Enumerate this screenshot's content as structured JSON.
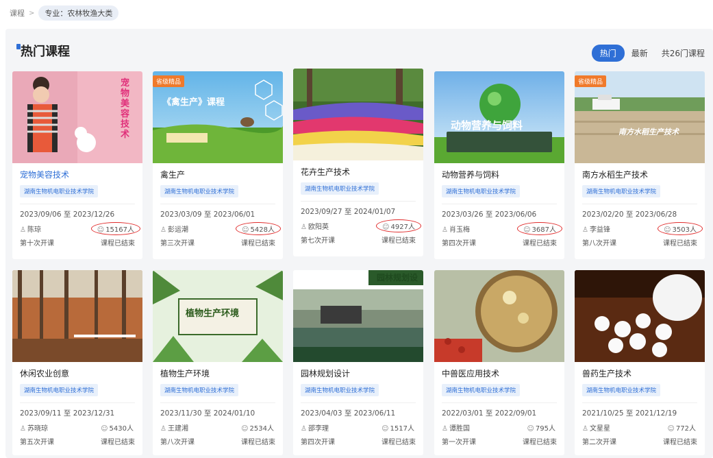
{
  "breadcrumb": {
    "root": "课程",
    "separator": ">",
    "current": "专业：农林牧渔大类"
  },
  "header": {
    "title": "热门课程",
    "tabs": [
      {
        "label": "热门",
        "active": true
      },
      {
        "label": "最新",
        "active": false
      }
    ],
    "count": "共26门课程"
  },
  "colors": {
    "accent": "#2f6fd6",
    "badge": "#f07a2b",
    "highlight_circle": "#e02a2a"
  },
  "courses": [
    {
      "name": "宠物美容技术",
      "school": "湖南生物机电职业技术学院",
      "dates": "2023/09/06 至 2023/12/26",
      "teacher": "陈琼",
      "learners": "15167人",
      "session": "第十次开课",
      "status": "课程已结束",
      "badge": "",
      "thumb_text": "宠物美容技术"
    },
    {
      "name": "禽生产",
      "school": "湖南生物机电职业技术学院",
      "dates": "2023/03/09 至 2023/06/01",
      "teacher": "彭运潮",
      "learners": "5428人",
      "session": "第三次开课",
      "status": "课程已结束",
      "badge": "省级精品",
      "thumb_text": "《禽生产》课程"
    },
    {
      "name": "花卉生产技术",
      "school": "湖南生物机电职业技术学院",
      "dates": "2023/09/27 至 2024/01/07",
      "teacher": "欧阳英",
      "learners": "4927人",
      "session": "第七次开课",
      "status": "课程已结束",
      "badge": "",
      "thumb_text": ""
    },
    {
      "name": "动物营养与饲料",
      "school": "湖南生物机电职业技术学院",
      "dates": "2023/03/26 至 2023/06/06",
      "teacher": "肖玉梅",
      "learners": "3687人",
      "session": "第四次开课",
      "status": "课程已结束",
      "badge": "",
      "thumb_text": "动物营养与饲料"
    },
    {
      "name": "南方水稻生产技术",
      "school": "湖南生物机电职业技术学院",
      "dates": "2023/02/20 至 2023/06/28",
      "teacher": "李益锋",
      "learners": "3503人",
      "session": "第八次开课",
      "status": "课程已结束",
      "badge": "省级精品",
      "thumb_text": "南方水稻生产技术"
    },
    {
      "name": "休闲农业创意",
      "school": "湖南生物机电职业技术学院",
      "dates": "2023/09/11 至 2023/12/31",
      "teacher": "苏晓琼",
      "learners": "5430人",
      "session": "第五次开课",
      "status": "课程已结束",
      "badge": "",
      "thumb_text": ""
    },
    {
      "name": "植物生产环境",
      "school": "湖南生物机电职业技术学院",
      "dates": "2023/11/30 至 2024/01/10",
      "teacher": "王建湘",
      "learners": "2534人",
      "session": "第八次开课",
      "status": "课程已结束",
      "badge": "",
      "thumb_text": "植物生产环境"
    },
    {
      "name": "园林规划设计",
      "school": "湖南生物机电职业技术学院",
      "dates": "2023/04/03 至 2023/06/11",
      "teacher": "邵李理",
      "learners": "1517人",
      "session": "第四次开课",
      "status": "课程已结束",
      "badge": "",
      "thumb_text": "园林规划设"
    },
    {
      "name": "中兽医应用技术",
      "school": "湖南生物机电职业技术学院",
      "dates": "2022/03/01 至 2022/09/01",
      "teacher": "谭胜国",
      "learners": "795人",
      "session": "第一次开课",
      "status": "课程已结束",
      "badge": "",
      "thumb_text": ""
    },
    {
      "name": "兽药生产技术",
      "school": "湖南生物机电职业技术学院",
      "dates": "2021/10/25 至 2021/12/19",
      "teacher": "文星星",
      "learners": "772人",
      "session": "第二次开课",
      "status": "课程已结束",
      "badge": "",
      "thumb_text": ""
    }
  ]
}
